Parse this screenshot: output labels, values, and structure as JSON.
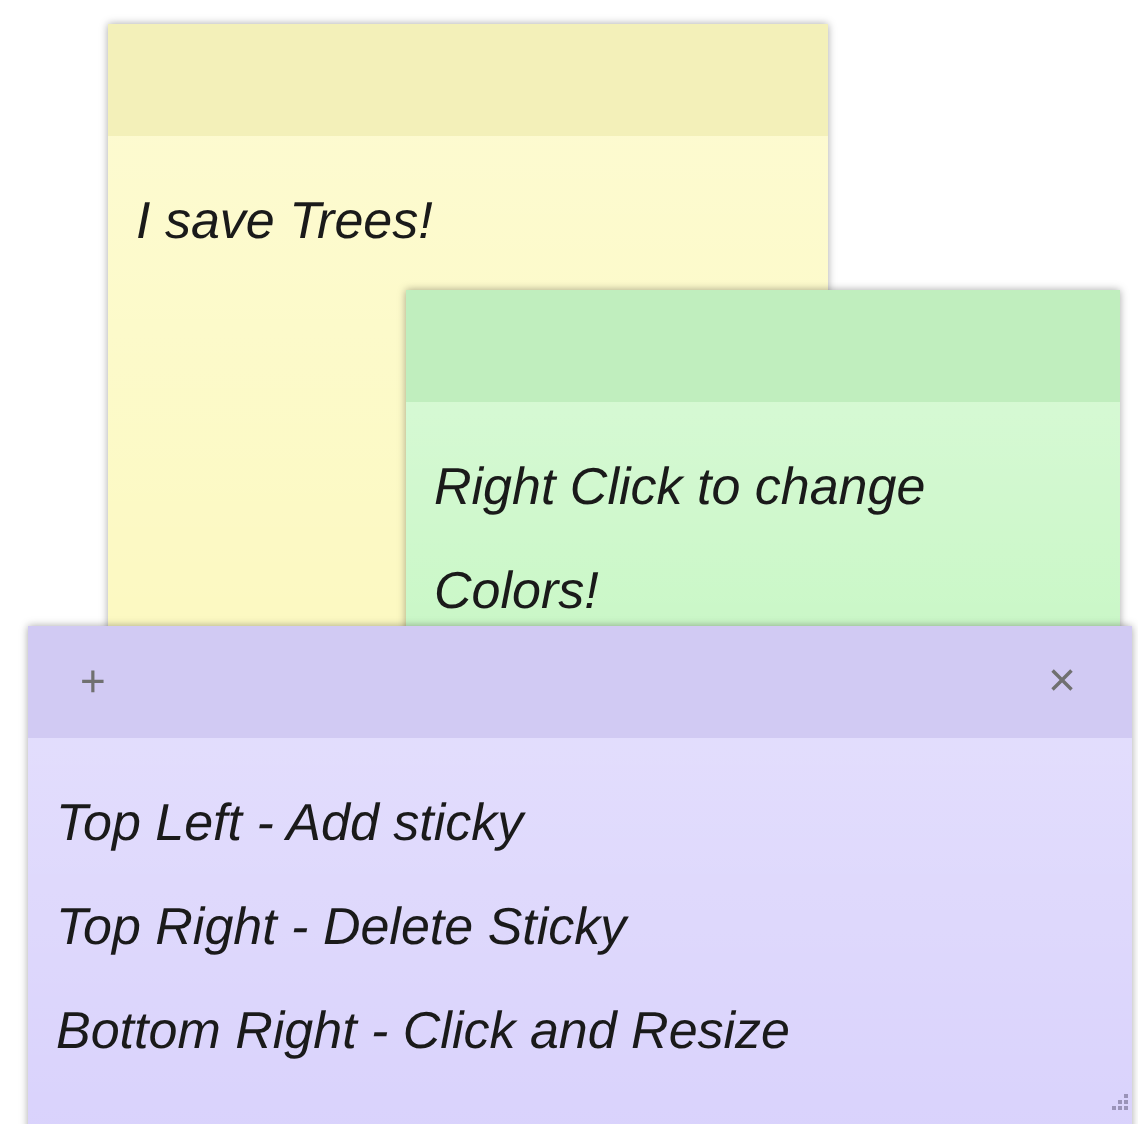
{
  "notes": [
    {
      "color": "#fcf9c0",
      "lines": [
        "I save Trees!"
      ]
    },
    {
      "color": "#c8f7c5",
      "lines": [
        "Right Click to change Colors!"
      ]
    },
    {
      "color": "#d9d2fc",
      "add_button": "+",
      "close_button": "×",
      "lines": [
        "Top Left - Add sticky",
        "Top Right - Delete Sticky",
        "Bottom Right - Click and Resize"
      ]
    }
  ]
}
